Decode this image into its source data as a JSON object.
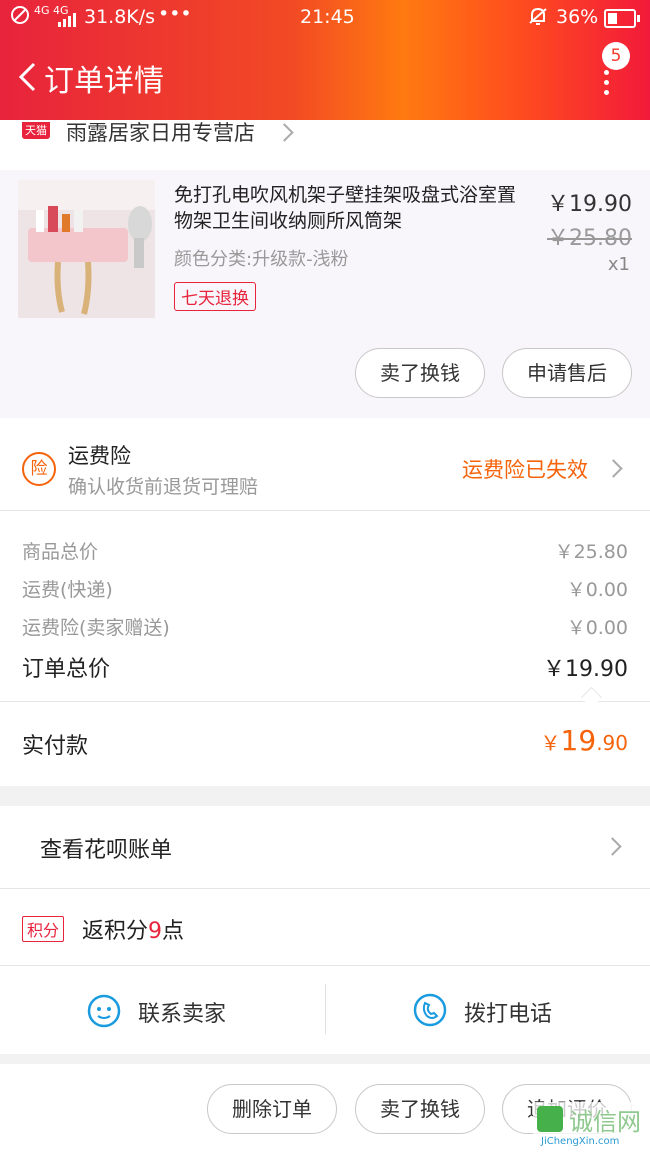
{
  "status_bar": {
    "network": "4G 4G",
    "speed": "31.8K/s",
    "more": "•••",
    "time": "21:45",
    "battery": "36%",
    "battery_level": 0.36
  },
  "header": {
    "title": "订单详情",
    "badge_count": "5"
  },
  "shop": {
    "tag": "天猫",
    "name": "雨露居家日用专营店"
  },
  "product": {
    "name": "免打孔电吹风机架子壁挂架吸盘式浴室置物架卫生间收纳厕所风筒架",
    "spec": "颜色分类:升级款-浅粉",
    "service_tag": "七天退换",
    "price": "￥19.90",
    "original_price": "￥25.80",
    "quantity": "x1",
    "btn_sell": "卖了换钱",
    "btn_aftersale": "申请售后"
  },
  "insurance": {
    "icon_char": "险",
    "title": "运费险",
    "subtitle": "确认收货前退货可理赔",
    "status": "运费险已失效"
  },
  "summary": {
    "rows": [
      {
        "label": "商品总价",
        "value": "￥25.80"
      },
      {
        "label": "运费(快递)",
        "value": "￥0.00"
      },
      {
        "label": "运费险(卖家赠送)",
        "value": "￥0.00"
      }
    ],
    "total_label": "订单总价",
    "total_value": "￥19.90",
    "paid_label": "实付款",
    "paid_symbol": "￥",
    "paid_int": "19",
    "paid_dec": ".90"
  },
  "huabei": {
    "label": "查看花呗账单"
  },
  "points": {
    "tag": "积分",
    "prefix": "返积分",
    "count": "9",
    "suffix": "点"
  },
  "contact": {
    "seller": "联系卖家",
    "call": "拨打电话"
  },
  "footer": {
    "delete": "删除订单",
    "sell": "卖了换钱",
    "review": "追加评价"
  },
  "watermark": {
    "brand": "诚信网",
    "url": "JiChengXin.com"
  },
  "colors": {
    "accent": "#e8233c",
    "orange": "#f5630a",
    "header_mid": "#ff7a10"
  }
}
